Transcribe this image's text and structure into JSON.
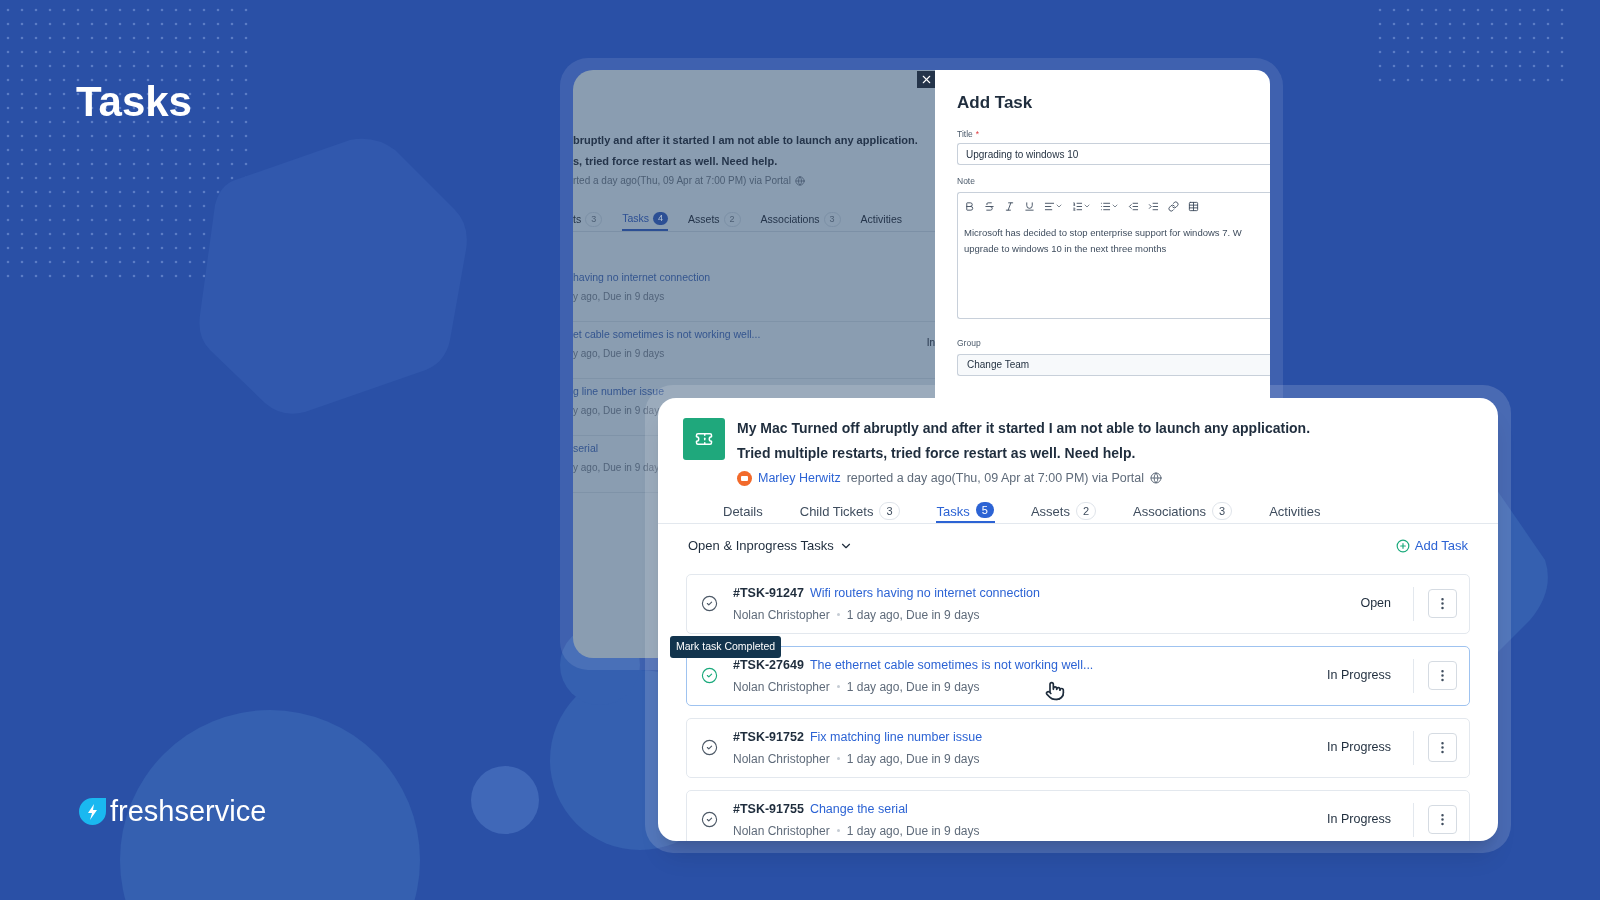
{
  "page_title": "Tasks",
  "brand": "freshservice",
  "background_ticket": {
    "subject_lines": [
      "bruptly and after it started I am not able to launch any application.",
      "s, tried force restart as well. Need help."
    ],
    "reported": "rted a day ago(Thu, 09 Apr at 7:00 PM) via Portal",
    "tabs": [
      {
        "label": "ts",
        "count": "3",
        "selected": false
      },
      {
        "label": "Tasks",
        "count": "4",
        "selected": true
      },
      {
        "label": "Assets",
        "count": "2",
        "selected": false
      },
      {
        "label": "Associations",
        "count": "3",
        "selected": false
      },
      {
        "label": "Activities",
        "selected": false
      }
    ],
    "tasks": [
      {
        "title": "having no internet connection",
        "meta": "y ago, Due in 9 days"
      },
      {
        "title": "et cable sometimes is not working well...",
        "meta": "y ago, Due in 9 days",
        "status": "In"
      },
      {
        "title": "g line number issue",
        "meta": "y ago, Due in 9 day"
      },
      {
        "title": "serial",
        "meta": "y ago, Due in 9 day"
      }
    ]
  },
  "add_task_drawer": {
    "heading": "Add Task",
    "title_label": "Title",
    "required_mark": "*",
    "title_value": "Upgrading to windows 10",
    "note_label": "Note",
    "note_lines": [
      "Microsoft has decided to stop enterprise support for windows 7. W",
      "upgrade to windows 10 in the next three months"
    ],
    "group_label": "Group",
    "group_value": "Change Team"
  },
  "ticket": {
    "subject_lines": [
      "My Mac Turned off abruptly and after it started I am not able to launch any application.",
      "Tried multiple restarts, tried force restart as well. Need help."
    ],
    "reporter": "Marley Herwitz",
    "reported": "reported a day ago(Thu, 09 Apr at 7:00 PM) via Portal",
    "tabs": [
      {
        "label": "Details",
        "selected": false
      },
      {
        "label": "Child Tickets",
        "count": "3",
        "selected": false
      },
      {
        "label": "Tasks",
        "count": "5",
        "selected": true
      },
      {
        "label": "Assets",
        "count": "2",
        "selected": false
      },
      {
        "label": "Associations",
        "count": "3",
        "selected": false
      },
      {
        "label": "Activities",
        "selected": false
      }
    ],
    "filter": "Open & Inprogress Tasks",
    "add_task": "Add Task",
    "tooltip": "Mark task Completed",
    "tasks": [
      {
        "id": "#TSK-91247",
        "title": "Wifi routers having no internet connection",
        "assignee": "Nolan Christopher",
        "when": "1 day ago, Due in 9 days",
        "status": "Open",
        "hovered": false
      },
      {
        "id": "#TSK-27649",
        "title": "The ethernet cable sometimes is not working well...",
        "assignee": "Nolan Christopher",
        "when": "1 day ago, Due in 9 days",
        "status": "In Progress",
        "hovered": true
      },
      {
        "id": "#TSK-91752",
        "title": "Fix matching line number issue",
        "assignee": "Nolan Christopher",
        "when": "1 day ago, Due in 9 days",
        "status": "In Progress",
        "hovered": false
      },
      {
        "id": "#TSK-91755",
        "title": "Change the serial",
        "assignee": "Nolan Christopher",
        "when": "1 day ago, Due in 9 days",
        "status": "In Progress",
        "hovered": false
      }
    ]
  }
}
